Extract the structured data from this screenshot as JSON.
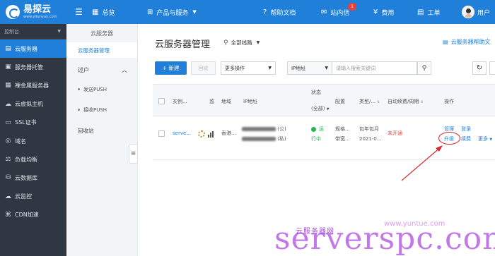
{
  "header": {
    "logo_title": "易探云",
    "logo_sub": "www.yitanyun.com",
    "menu_icon": "hamburger-icon",
    "overview": "总览",
    "products": "产品与服务",
    "help_docs": "帮助文档",
    "messages": "站内信",
    "messages_badge": "1",
    "billing": "费用",
    "tickets": "工单",
    "user": "用户"
  },
  "sidebar": {
    "heading": "控制台",
    "items": [
      {
        "label": "云服务器",
        "icon": "server-icon"
      },
      {
        "label": "服务器托管",
        "icon": "rack-icon"
      },
      {
        "label": "裸金属服务器",
        "icon": "bare-metal-icon"
      },
      {
        "label": "云虚拟主机",
        "icon": "cloud-host-icon"
      },
      {
        "label": "SSL证书",
        "icon": "certificate-icon"
      },
      {
        "label": "域名",
        "icon": "globe-icon"
      },
      {
        "label": "负载均衡",
        "icon": "balance-icon"
      },
      {
        "label": "云数据库",
        "icon": "database-icon"
      },
      {
        "label": "云监控",
        "icon": "monitor-icon"
      },
      {
        "label": "CDN加速",
        "icon": "cdn-icon"
      }
    ]
  },
  "subnav": {
    "heading": "云服务器",
    "manage": "云服务器管理",
    "transfer": "过户",
    "send_push": "发送PUSH",
    "receive_push": "接收PUSH",
    "recycle": "回收站"
  },
  "main": {
    "title": "云服务器管理",
    "region": "全部线路",
    "help_link": "云服务器帮助文",
    "new_button": "+ 新建",
    "disabled_button": "回收",
    "more_ops": "更多操作",
    "ip_select": "IP地址",
    "search_placeholder": "请输入搜索关键词"
  },
  "table": {
    "headers": {
      "instance": "实例...",
      "monitor": "监",
      "region": "地域",
      "ip": "IP地址",
      "status": "状态",
      "status_filter": "(全部)",
      "config": "配置",
      "type": "类型/...",
      "renew": "自动续费/周期",
      "ops": "操作"
    },
    "row": {
      "instance": "serve...",
      "region": "香港...",
      "ip_public": "(公)",
      "ip_private": "(私)",
      "status_1": "运",
      "status_2": "行中",
      "config_1": "规格...",
      "config_2": "带宽...",
      "type_1": "包年包月",
      "type_2": "2021-0...",
      "renew": "未开通",
      "op_manage": "管理",
      "op_login": "登录",
      "op_upgrade": "升级",
      "op_renew": "续费",
      "op_more": "更多"
    }
  },
  "watermark": {
    "small": "云服务器网",
    "big": "serverspc.com",
    "url": "www.yuntue.com"
  },
  "colors": {
    "primary": "#1f7fd9",
    "sidebar_bg": "#2f3742",
    "status_green": "#2bb24c",
    "alert_red": "#e9403b",
    "annotation_red": "#d7282f",
    "watermark_purple": "#b04be0"
  }
}
